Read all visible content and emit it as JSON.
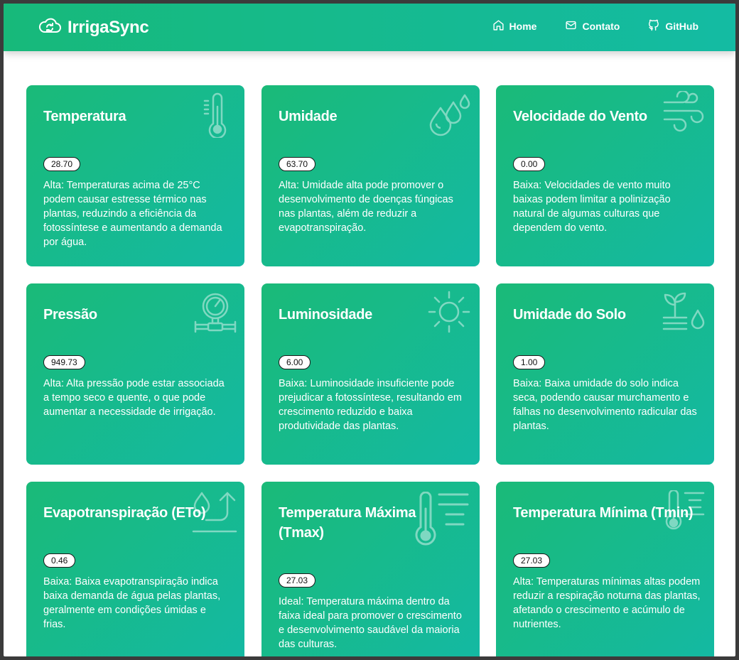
{
  "navbar": {
    "brand": "IrrigaSync",
    "links": [
      {
        "label": "Home",
        "icon": "home-icon"
      },
      {
        "label": "Contato",
        "icon": "mail-icon"
      },
      {
        "label": "GitHub",
        "icon": "github-icon"
      }
    ]
  },
  "colors": {
    "gradient_start": "#1aba78",
    "gradient_end": "#14b9a3"
  },
  "cards": [
    {
      "title": "Temperatura",
      "value": "28.70",
      "icon": "thermometer-icon",
      "description": "Alta: Temperaturas acima de 25°C podem causar estresse térmico nas plantas, reduzindo a eficiência da fotossíntese e aumentando a demanda por água."
    },
    {
      "title": "Umidade",
      "value": "63.70",
      "icon": "droplets-icon",
      "description": "Alta: Umidade alta pode promover o desenvolvimento de doenças fúngicas nas plantas, além de reduzir a evapotranspiração."
    },
    {
      "title": "Velocidade do Vento",
      "value": "0.00",
      "icon": "wind-icon",
      "description": "Baixa: Velocidades de vento muito baixas podem limitar a polinização natural de algumas culturas que dependem do vento."
    },
    {
      "title": "Pressão",
      "value": "949.73",
      "icon": "pressure-gauge-icon",
      "description": "Alta: Alta pressão pode estar associada a tempo seco e quente, o que pode aumentar a necessidade de irrigação."
    },
    {
      "title": "Luminosidade",
      "value": "6.00",
      "icon": "sun-icon",
      "description": "Baixa: Luminosidade insuficiente pode prejudicar a fotossíntese, resultando em crescimento reduzido e baixa produtividade das plantas."
    },
    {
      "title": "Umidade do Solo",
      "value": "1.00",
      "icon": "soil-moisture-icon",
      "description": "Baixa: Baixa umidade do solo indica seca, podendo causar murchamento e falhas no desenvolvimento radicular das plantas."
    },
    {
      "title": "Evapotranspiração (ETo)",
      "value": "0.46",
      "icon": "evapotranspiration-icon",
      "description": "Baixa: Baixa evapotranspiração indica baixa demanda de água pelas plantas, geralmente em condições úmidas e frias."
    },
    {
      "title": "Temperatura Máxima (Tmax)",
      "value": "27.03",
      "icon": "thermometer-high-icon",
      "description": "Ideal: Temperatura máxima dentro da faixa ideal para promover o crescimento e desenvolvimento saudável da maioria das culturas."
    },
    {
      "title": "Temperatura Mínima (Tmin)",
      "value": "27.03",
      "icon": "thermometer-low-icon",
      "description": "Alta: Temperaturas mínimas altas podem reduzir a respiração noturna das plantas, afetando o crescimento e acúmulo de nutrientes."
    }
  ]
}
